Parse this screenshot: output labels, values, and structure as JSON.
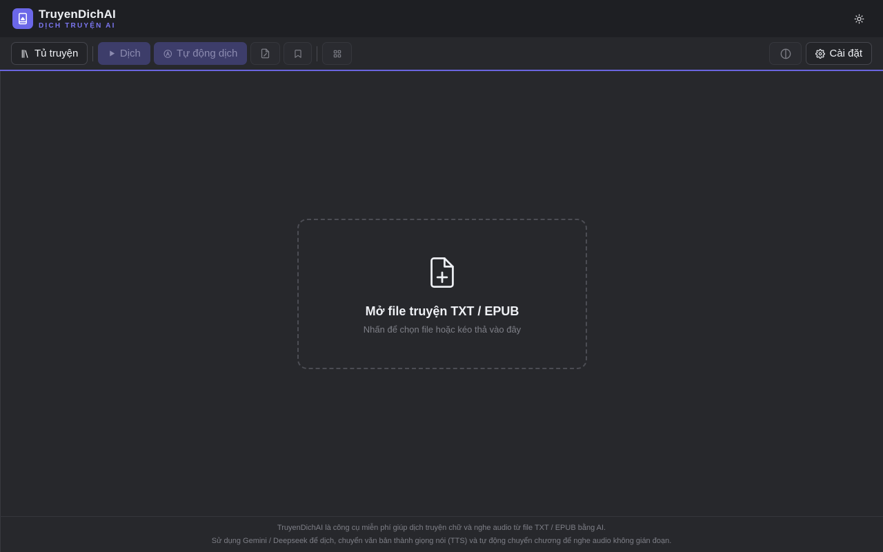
{
  "app": {
    "name": "TruyenDichAI",
    "tagline": "DỊCH TRUYỆN AI",
    "accent": "#6b67e8"
  },
  "header": {
    "theme_toggle_icon": "sun-icon"
  },
  "toolbar": {
    "library_label": "Tủ truyện",
    "translate_label": "Dịch",
    "auto_translate_label": "Tự động dịch",
    "edit_icon": "file-edit-icon",
    "bookmark_icon": "bookmark-icon",
    "grid_icon": "grid-icon",
    "compare_icon": "split-circle-icon",
    "settings_label": "Cài đặt"
  },
  "dropzone": {
    "icon": "file-plus-icon",
    "title": "Mở file truyện TXT / EPUB",
    "subtitle": "Nhấn để chọn file hoặc kéo thả vào đây"
  },
  "footer": {
    "line1": "TruyenDichAI là công cụ miễn phí giúp dịch truyện chữ và nghe audio từ file TXT / EPUB bằng AI.",
    "line2": "Sử dụng Gemini / Deepseek để dịch, chuyển văn bản thành giọng nói (TTS) và tự động chuyển chương để nghe audio không gián đoạn."
  }
}
